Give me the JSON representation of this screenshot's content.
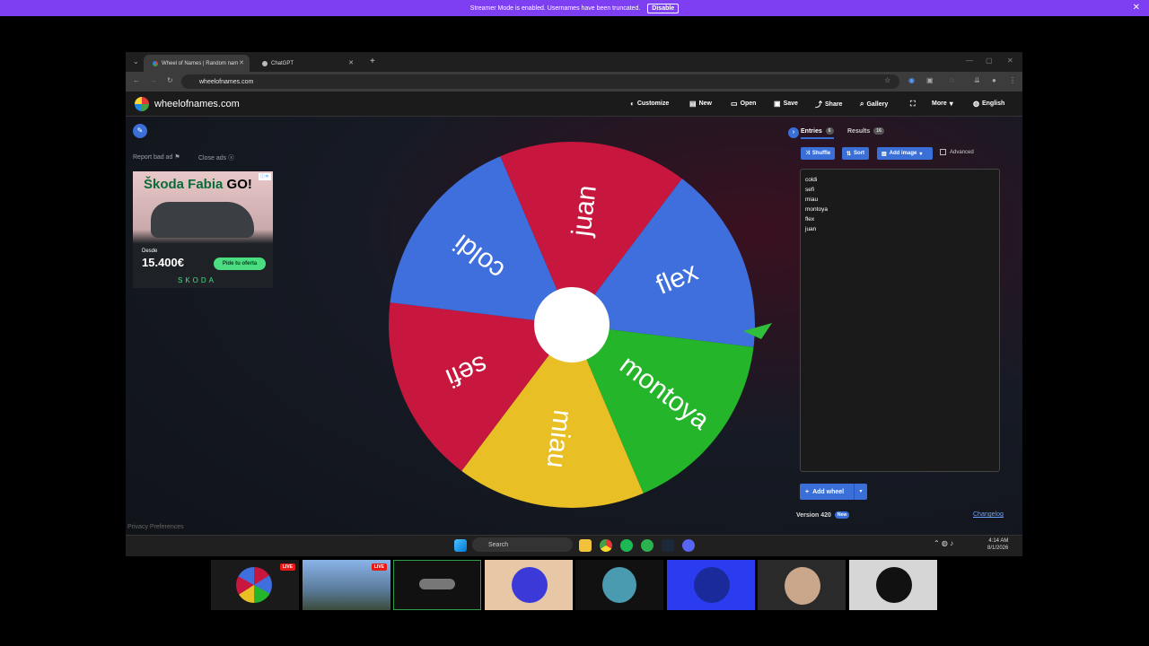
{
  "streamer": {
    "message": "Streamer Mode is enabled. Usernames have been truncated.",
    "disable_label": "Disable",
    "close": "✕"
  },
  "browser": {
    "tabs": [
      {
        "label": "Wheel of Names | Random nam",
        "active": true
      },
      {
        "label": "ChatGPT",
        "active": false
      }
    ],
    "new_tab": "+",
    "url": "wheelofnames.com"
  },
  "site": {
    "brand": "wheelofnames.com",
    "nav": [
      "Customize",
      "New",
      "Open",
      "Save",
      "Share",
      "Gallery",
      "More",
      "English"
    ],
    "report_ad": "Report bad ad",
    "close_ads": "Close ads",
    "ad": {
      "headline_a": "Škoda Fabia ",
      "headline_b": "GO!",
      "desde": "Desde",
      "price": "15.400€",
      "cta": "Pide tu oferta",
      "brand": "SKODA",
      "privacy": "Privacy Preferences"
    },
    "colors": {
      "red": "#c8173f",
      "blue": "#3e6fdc",
      "green": "#25b52a",
      "yellow": "#e8c026",
      "accent": "#3b6fd8"
    }
  },
  "wheel": {
    "slices": [
      {
        "name": "juan",
        "color": "#c8173f"
      },
      {
        "name": "flex",
        "color": "#3e6fdc"
      },
      {
        "name": "montoya",
        "color": "#25b52a"
      },
      {
        "name": "miau",
        "color": "#e8c026"
      },
      {
        "name": "sefi",
        "color": "#c8173f"
      },
      {
        "name": "coldi",
        "color": "#3e6fdc"
      }
    ]
  },
  "panel": {
    "entries_tab": "Entries",
    "entries_count": "6",
    "results_tab": "Results",
    "results_count": "16",
    "shuffle": "Shuffle",
    "sort": "Sort",
    "add_image": "Add image",
    "advanced": "Advanced",
    "entries": [
      "coldi",
      "sefi",
      "miau",
      "montoya",
      "flex",
      "juan"
    ],
    "add_wheel": "Add wheel",
    "version": "Version 420",
    "new_badge": "New",
    "changelog": "Changelog"
  },
  "taskbar": {
    "search": "Search",
    "time": "4:14 AM",
    "date": "8/1/2026"
  },
  "thumbs": [
    {
      "live": "LIVE"
    },
    {
      "live": "LIVE"
    },
    {},
    {},
    {},
    {},
    {},
    {}
  ]
}
